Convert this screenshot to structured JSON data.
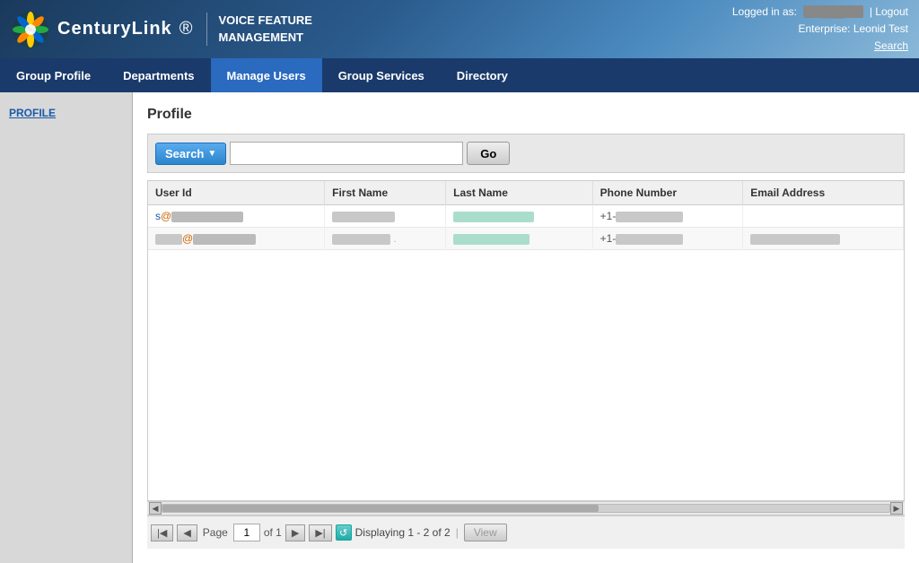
{
  "header": {
    "logo_text": "CenturyLink",
    "app_title_line1": "VOICE FEATURE",
    "app_title_line2": "MANAGEMENT",
    "logged_in_label": "Logged in as:",
    "logged_in_user": "▓▓▓▓▓▓▓",
    "logout_label": "| Logout",
    "enterprise_label": "Enterprise: Leonid Test",
    "search_label": "Search"
  },
  "nav": {
    "items": [
      {
        "label": "Group Profile",
        "id": "group-profile",
        "active": false
      },
      {
        "label": "Departments",
        "id": "departments",
        "active": false
      },
      {
        "label": "Manage Users",
        "id": "manage-users",
        "active": true
      },
      {
        "label": "Group Services",
        "id": "group-services",
        "active": false
      },
      {
        "label": "Directory",
        "id": "directory",
        "active": false
      }
    ]
  },
  "sidebar": {
    "items": [
      {
        "label": "PROFILE",
        "id": "profile"
      }
    ]
  },
  "content": {
    "page_title": "Profile",
    "search": {
      "button_label": "Search",
      "go_label": "Go",
      "placeholder": ""
    },
    "table": {
      "columns": [
        "User Id",
        "First Name",
        "Last Name",
        "Phone Number",
        "Email Address"
      ],
      "rows": [
        {
          "user_id_prefix": "s",
          "user_id_at": "@",
          "user_id_suffix": "▓▓▓▓▓▓▓",
          "first_name": "▓▓▓▓▓▓▓",
          "last_name": "▓▓▓▓▓▓▓▓▓▓",
          "phone": "+1-▓▓▓▓▓▓▓▓▓",
          "email": ""
        },
        {
          "user_id_prefix": "",
          "user_id_at": "@",
          "user_id_suffix": "▓▓▓▓▓▓▓",
          "first_name": "▓▓▓▓▓▓▓",
          "last_name": "▓▓▓▓▓▓▓▓▓",
          "phone": "+1-▓▓▓▓▓▓▓▓▓",
          "email": "▓▓▓▓▓▓▓▓▓▓▓"
        }
      ]
    },
    "pagination": {
      "page_label": "Page",
      "current_page": "1",
      "of_label": "of 1",
      "displaying": "Displaying 1 - 2 of 2",
      "view_label": "View"
    }
  }
}
